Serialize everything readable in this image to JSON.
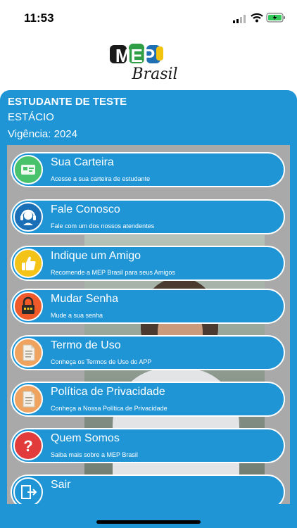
{
  "status_bar": {
    "time": "11:53"
  },
  "logo": {
    "text_main": "MEP",
    "text_sub": "Brasil"
  },
  "user": {
    "name": "ESTUDANTE DE TESTE",
    "institution": "ESTÁCIO",
    "validity": "Vigência: 2024"
  },
  "menu": [
    {
      "title": "Sua Carteira",
      "subtitle": "Acesse a sua carteira de estudante",
      "icon": "id-card-icon",
      "color": "#49c36b"
    },
    {
      "title": "Fale Conosco",
      "subtitle": "Fale com um dos nossos atendentes",
      "icon": "headset-icon",
      "color": "#1b6fb7"
    },
    {
      "title": "Indique um Amigo",
      "subtitle": "Recomende a MEP Brasil para seus Amigos",
      "icon": "thumbs-up-icon",
      "color": "#f3c317"
    },
    {
      "title": "Mudar Senha",
      "subtitle": "Mude a sua senha",
      "icon": "lock-icon",
      "color": "#f05a28"
    },
    {
      "title": "Termo de Uso",
      "subtitle": "Conheça os Termos de Uso do APP",
      "icon": "document-icon",
      "color": "#f0a35e"
    },
    {
      "title": "Política de Privacidade",
      "subtitle": "Conheça a Nossa Política de Privacidade",
      "icon": "document-icon",
      "color": "#f0a35e"
    },
    {
      "title": "Quem Somos",
      "subtitle": "Saiba mais sobre a MEP Brasil",
      "icon": "question-icon",
      "color": "#e23b3b"
    },
    {
      "title": "Sair",
      "subtitle": "",
      "icon": "exit-icon",
      "color": "#1f95d6"
    }
  ]
}
